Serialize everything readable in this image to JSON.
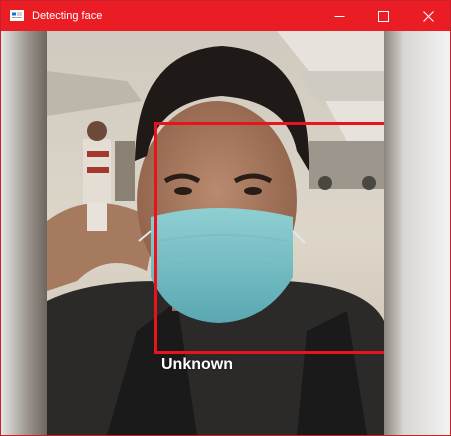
{
  "window": {
    "title": "Detecting face",
    "accent_color": "#ea1c24",
    "controls": [
      {
        "name": "minimize",
        "icon": "minimize-icon"
      },
      {
        "name": "maximize",
        "icon": "maximize-icon"
      },
      {
        "name": "close",
        "icon": "close-icon"
      }
    ]
  },
  "detection": {
    "label": "Unknown",
    "box_color": "#e8131d"
  }
}
